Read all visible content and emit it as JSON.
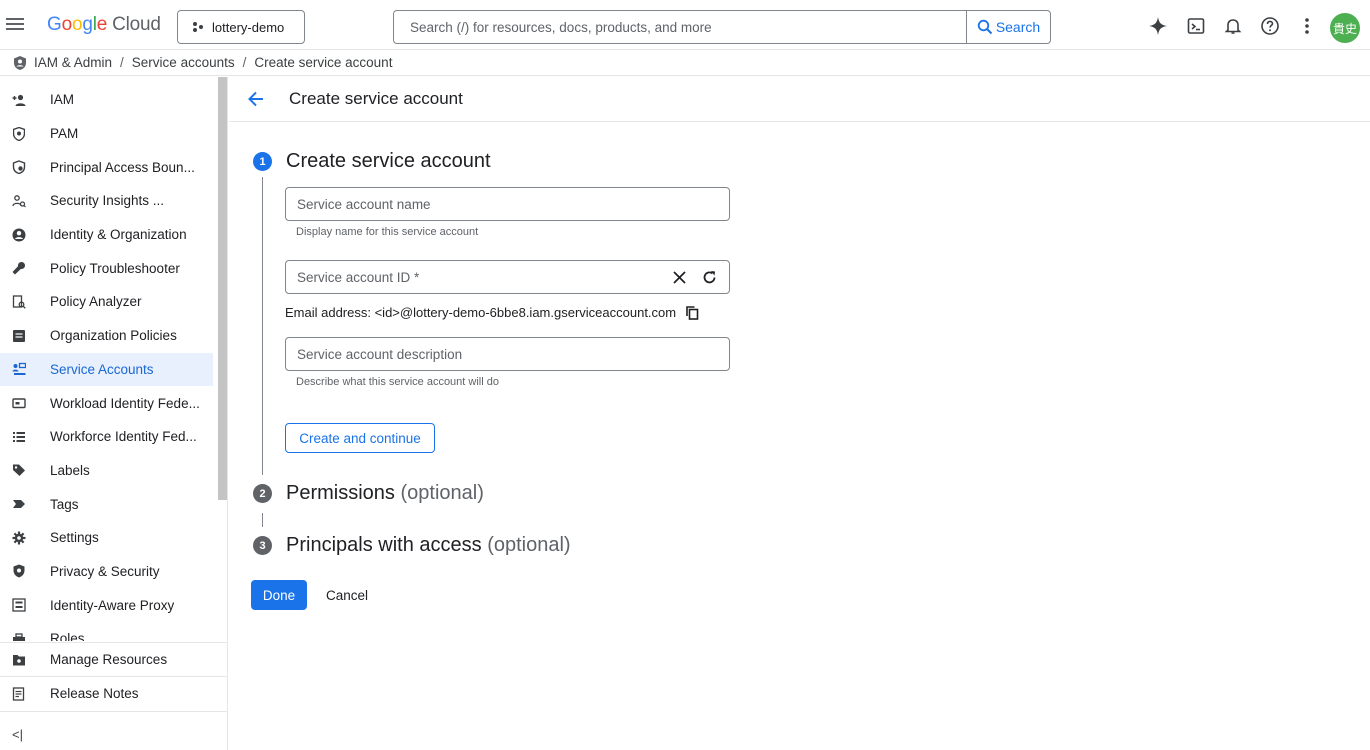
{
  "topbar": {
    "logo": {
      "g": "G",
      "o1": "o",
      "o2": "o",
      "g2": "g",
      "l": "l",
      "e": "e",
      "cloud": "Cloud"
    },
    "project": "lottery-demo",
    "search_placeholder": "Search (/) for resources, docs, products, and more",
    "search_button": "Search",
    "avatar_initials": "貴史",
    "icons": [
      "gemini-spark-icon",
      "cloud-shell-icon",
      "notifications-icon",
      "help-icon",
      "more-vert-icon"
    ]
  },
  "breadcrumb": [
    "IAM & Admin",
    "Service accounts",
    "Create service account"
  ],
  "sidebar": {
    "items": [
      {
        "label": "IAM",
        "icon": "person-add-icon"
      },
      {
        "label": "PAM",
        "icon": "shield-icon"
      },
      {
        "label": "Principal Access Boun...",
        "icon": "principal-access-icon"
      },
      {
        "label": "Security Insights ...",
        "icon": "security-insights-icon"
      },
      {
        "label": "Identity & Organization",
        "icon": "account-circle-icon"
      },
      {
        "label": "Policy Troubleshooter",
        "icon": "wrench-icon"
      },
      {
        "label": "Policy Analyzer",
        "icon": "policy-analyzer-icon"
      },
      {
        "label": "Organization Policies",
        "icon": "list-alt-icon"
      },
      {
        "label": "Service Accounts",
        "icon": "service-account-icon",
        "active": true
      },
      {
        "label": "Workload Identity Fede...",
        "icon": "badge-icon"
      },
      {
        "label": "Workforce Identity Fed...",
        "icon": "list-icon"
      },
      {
        "label": "Labels",
        "icon": "label-icon"
      },
      {
        "label": "Tags",
        "icon": "tag-icon"
      },
      {
        "label": "Settings",
        "icon": "gear-icon"
      },
      {
        "label": "Privacy & Security",
        "icon": "privacy-shield-icon"
      },
      {
        "label": "Identity-Aware Proxy",
        "icon": "proxy-icon"
      },
      {
        "label": "Roles",
        "icon": "roles-icon"
      }
    ],
    "bottom": [
      {
        "label": "Manage Resources",
        "icon": "manage-resources-icon"
      },
      {
        "label": "Release Notes",
        "icon": "release-notes-icon"
      }
    ],
    "collapse": "<|"
  },
  "page": {
    "title": "Create service account",
    "steps": [
      {
        "num": "1",
        "title": "Create service account",
        "optional": ""
      },
      {
        "num": "2",
        "title": "Permissions",
        "optional": "(optional)"
      },
      {
        "num": "3",
        "title": "Principals with access",
        "optional": "(optional)"
      }
    ],
    "fields": {
      "name_placeholder": "Service account name",
      "name_hint": "Display name for this service account",
      "id_placeholder": "Service account ID *",
      "email": "Email address: <id>@lottery-demo-6bbe8.iam.gserviceaccount.com",
      "description_placeholder": "Service account description",
      "description_hint": "Describe what this service account will do"
    },
    "buttons": {
      "create_continue": "Create and continue",
      "done": "Done",
      "cancel": "Cancel"
    }
  }
}
